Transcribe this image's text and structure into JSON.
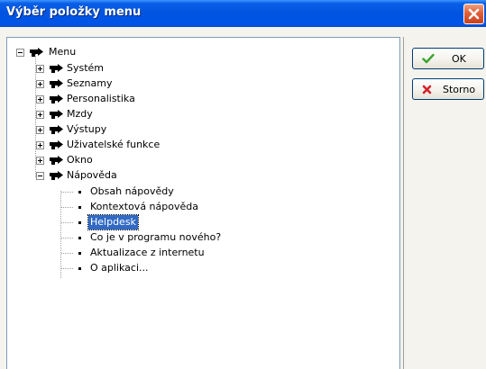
{
  "window": {
    "title": "Výběr položky menu"
  },
  "buttons": {
    "ok_label": "OK",
    "cancel_label": "Storno"
  },
  "tree": {
    "root": {
      "label": "Menu"
    },
    "items": [
      {
        "label": "Systém"
      },
      {
        "label": "Seznamy"
      },
      {
        "label": "Personalistika"
      },
      {
        "label": "Mzdy"
      },
      {
        "label": "Výstupy"
      },
      {
        "label": "Uživatelské funkce"
      },
      {
        "label": "Okno"
      },
      {
        "label": "Nápověda"
      }
    ],
    "help_children": [
      {
        "label": "Obsah nápovědy"
      },
      {
        "label": "Kontextová nápověda"
      },
      {
        "label": "Helpdesk",
        "selected": true
      },
      {
        "label": "Co je v programu nového?"
      },
      {
        "label": "Aktualizace z internetu"
      },
      {
        "label": "O aplikaci..."
      }
    ]
  },
  "colors": {
    "title_bar": "#0053e0",
    "selection": "#316ac5",
    "ok_check": "#3aa52c",
    "cancel_x": "#d4222a"
  }
}
